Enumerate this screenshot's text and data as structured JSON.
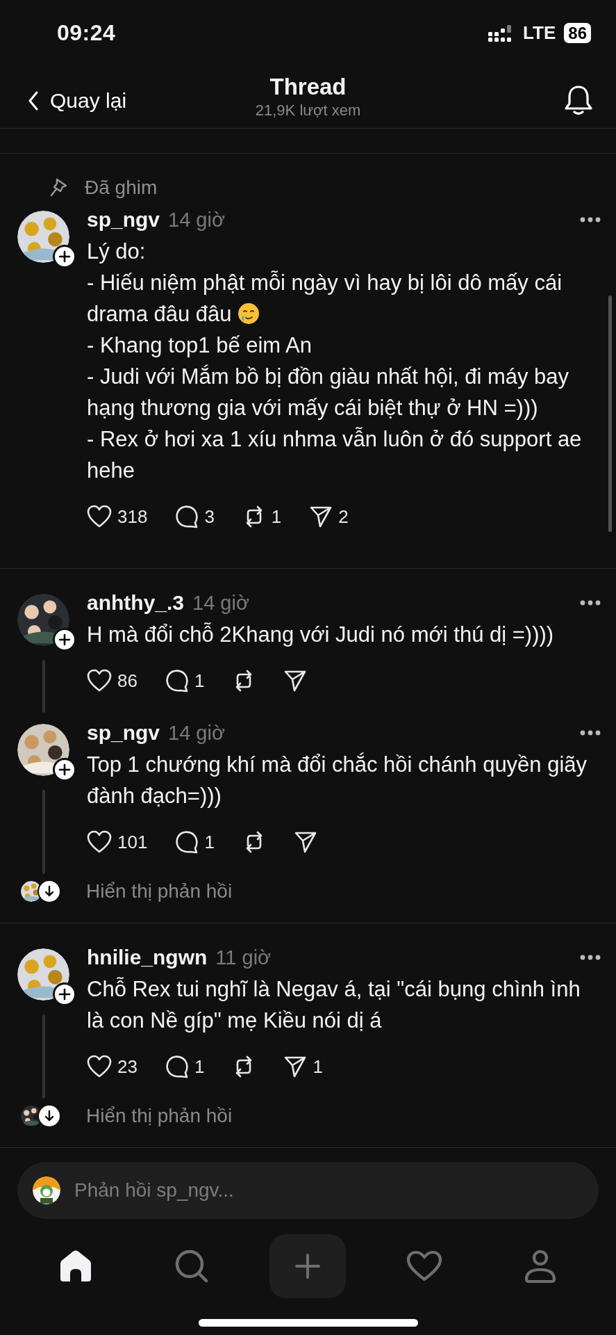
{
  "status_bar": {
    "time": "09:24",
    "network": "LTE",
    "battery": "86"
  },
  "header": {
    "back_label": "Quay lại",
    "title": "Thread",
    "subtitle": "21,9K lượt xem"
  },
  "groups": [
    {
      "pinned_label": "Đã ghim",
      "posts": [
        {
          "author": "sp_ngv",
          "time": "14 giờ",
          "has_replies": false,
          "paragraphs": [
            {
              "text": "Lý do:"
            },
            {
              "text": "- Hiếu niệm phật mỗi ngày vì hay bị lôi dô mấy cái drama đâu đâu",
              "emoji_after": true
            },
            {
              "text": "- Khang top1 bế eim An"
            },
            {
              "text": "- Judi với Mắm bồ bị đồn giàu nhất hội, đi máy bay hạng thương gia với mấy cái biệt thự ở HN =)))"
            },
            {
              "text": "- Rex ở hơi xa 1 xíu nhma vẫn luôn ở đó support ae hehe"
            }
          ],
          "actions": [
            {
              "kind": "like",
              "count": "318"
            },
            {
              "kind": "reply",
              "count": "3"
            },
            {
              "kind": "repost",
              "count": "1"
            },
            {
              "kind": "share",
              "count": "2"
            }
          ]
        }
      ]
    },
    {
      "posts": [
        {
          "author": "anhthy_.3",
          "time": "14 giờ",
          "has_replies": true,
          "paragraphs": [
            {
              "text": "H mà đổi chỗ 2Khang với Judi nó mới thú dị =))))"
            }
          ],
          "actions": [
            {
              "kind": "like",
              "count": "86"
            },
            {
              "kind": "reply",
              "count": "1"
            },
            {
              "kind": "repost"
            },
            {
              "kind": "share"
            }
          ]
        },
        {
          "author": "sp_ngv",
          "time": "14 giờ",
          "has_replies": true,
          "paragraphs": [
            {
              "text": "Top 1 chướng khí mà đổi chắc hồi chánh quyền giãy đành đạch=)))"
            }
          ],
          "actions": [
            {
              "kind": "like",
              "count": "101"
            },
            {
              "kind": "reply",
              "count": "1"
            },
            {
              "kind": "repost"
            },
            {
              "kind": "share"
            }
          ]
        }
      ],
      "show_replies": "Hiển thị phản hồi"
    },
    {
      "posts": [
        {
          "author": "hnilie_ngwn",
          "time": "11 giờ",
          "has_replies": true,
          "paragraphs": [
            {
              "text": "Chỗ Rex tui nghĩ là Negav á, tại \"cái bụng chình ình là con Nề gíp\" mẹ Kiều nói dị á"
            }
          ],
          "actions": [
            {
              "kind": "like",
              "count": "23"
            },
            {
              "kind": "reply",
              "count": "1"
            },
            {
              "kind": "repost"
            },
            {
              "kind": "share",
              "count": "1"
            }
          ]
        }
      ],
      "show_replies": "Hiển thị phản hồi"
    }
  ],
  "reply_field": {
    "placeholder": "Phản hồi sp_ngv..."
  },
  "nav": [
    {
      "kind": "home",
      "selected": true
    },
    {
      "kind": "search",
      "selected": false
    },
    {
      "kind": "compose",
      "selected": false
    },
    {
      "kind": "activity",
      "selected": false
    },
    {
      "kind": "profile",
      "selected": false
    }
  ]
}
